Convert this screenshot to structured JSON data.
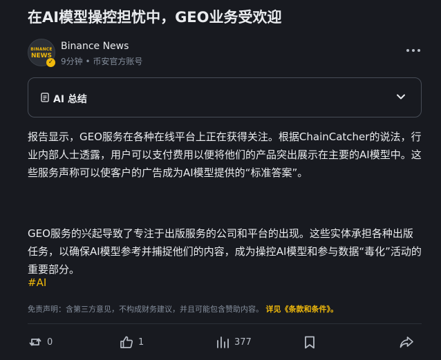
{
  "article": {
    "title": "在AI模型操控担忧中，GEO业务受欢迎",
    "author": {
      "name": "Binance News",
      "meta": "9分钟 • 币安官方账号",
      "avatar_text_top": "BINANCE",
      "avatar_text_bottom": "NEWS"
    },
    "summary_label": "AI 总结",
    "paragraphs": [
      "报告显示，GEO服务在各种在线平台上正在获得关注。根据ChainCatcher的说法，行业内部人士透露，用户可以支付费用以便将他们的产品突出展示在主要的AI模型中。这些服务声称可以使客户的广告成为AI模型提供的“标准答案”。",
      "GEO服务的兴起导致了专注于出版服务的公司和平台的出现。这些实体承担各种出版任务，以确保AI模型参考并捕捉他们的内容，成为操控AI模型和参与数据“毒化”活动的重要部分。"
    ],
    "hashtag": "#AI",
    "disclaimer": {
      "text": "免责声明：含第三方意见，不构成财务建议，并且可能包含赞助内容。",
      "link": "详见《条款和条件》。"
    }
  },
  "actions": {
    "repost_count": "0",
    "like_count": "1",
    "views_count": "377"
  },
  "colors": {
    "background": "#181a20",
    "accent": "#f0b90b",
    "text": "#eaecef",
    "muted": "#848e9c"
  },
  "icons": [
    "more-icon",
    "document-icon",
    "chevron-down-icon",
    "repost-icon",
    "like-icon",
    "views-icon",
    "bookmark-icon",
    "share-icon"
  ]
}
